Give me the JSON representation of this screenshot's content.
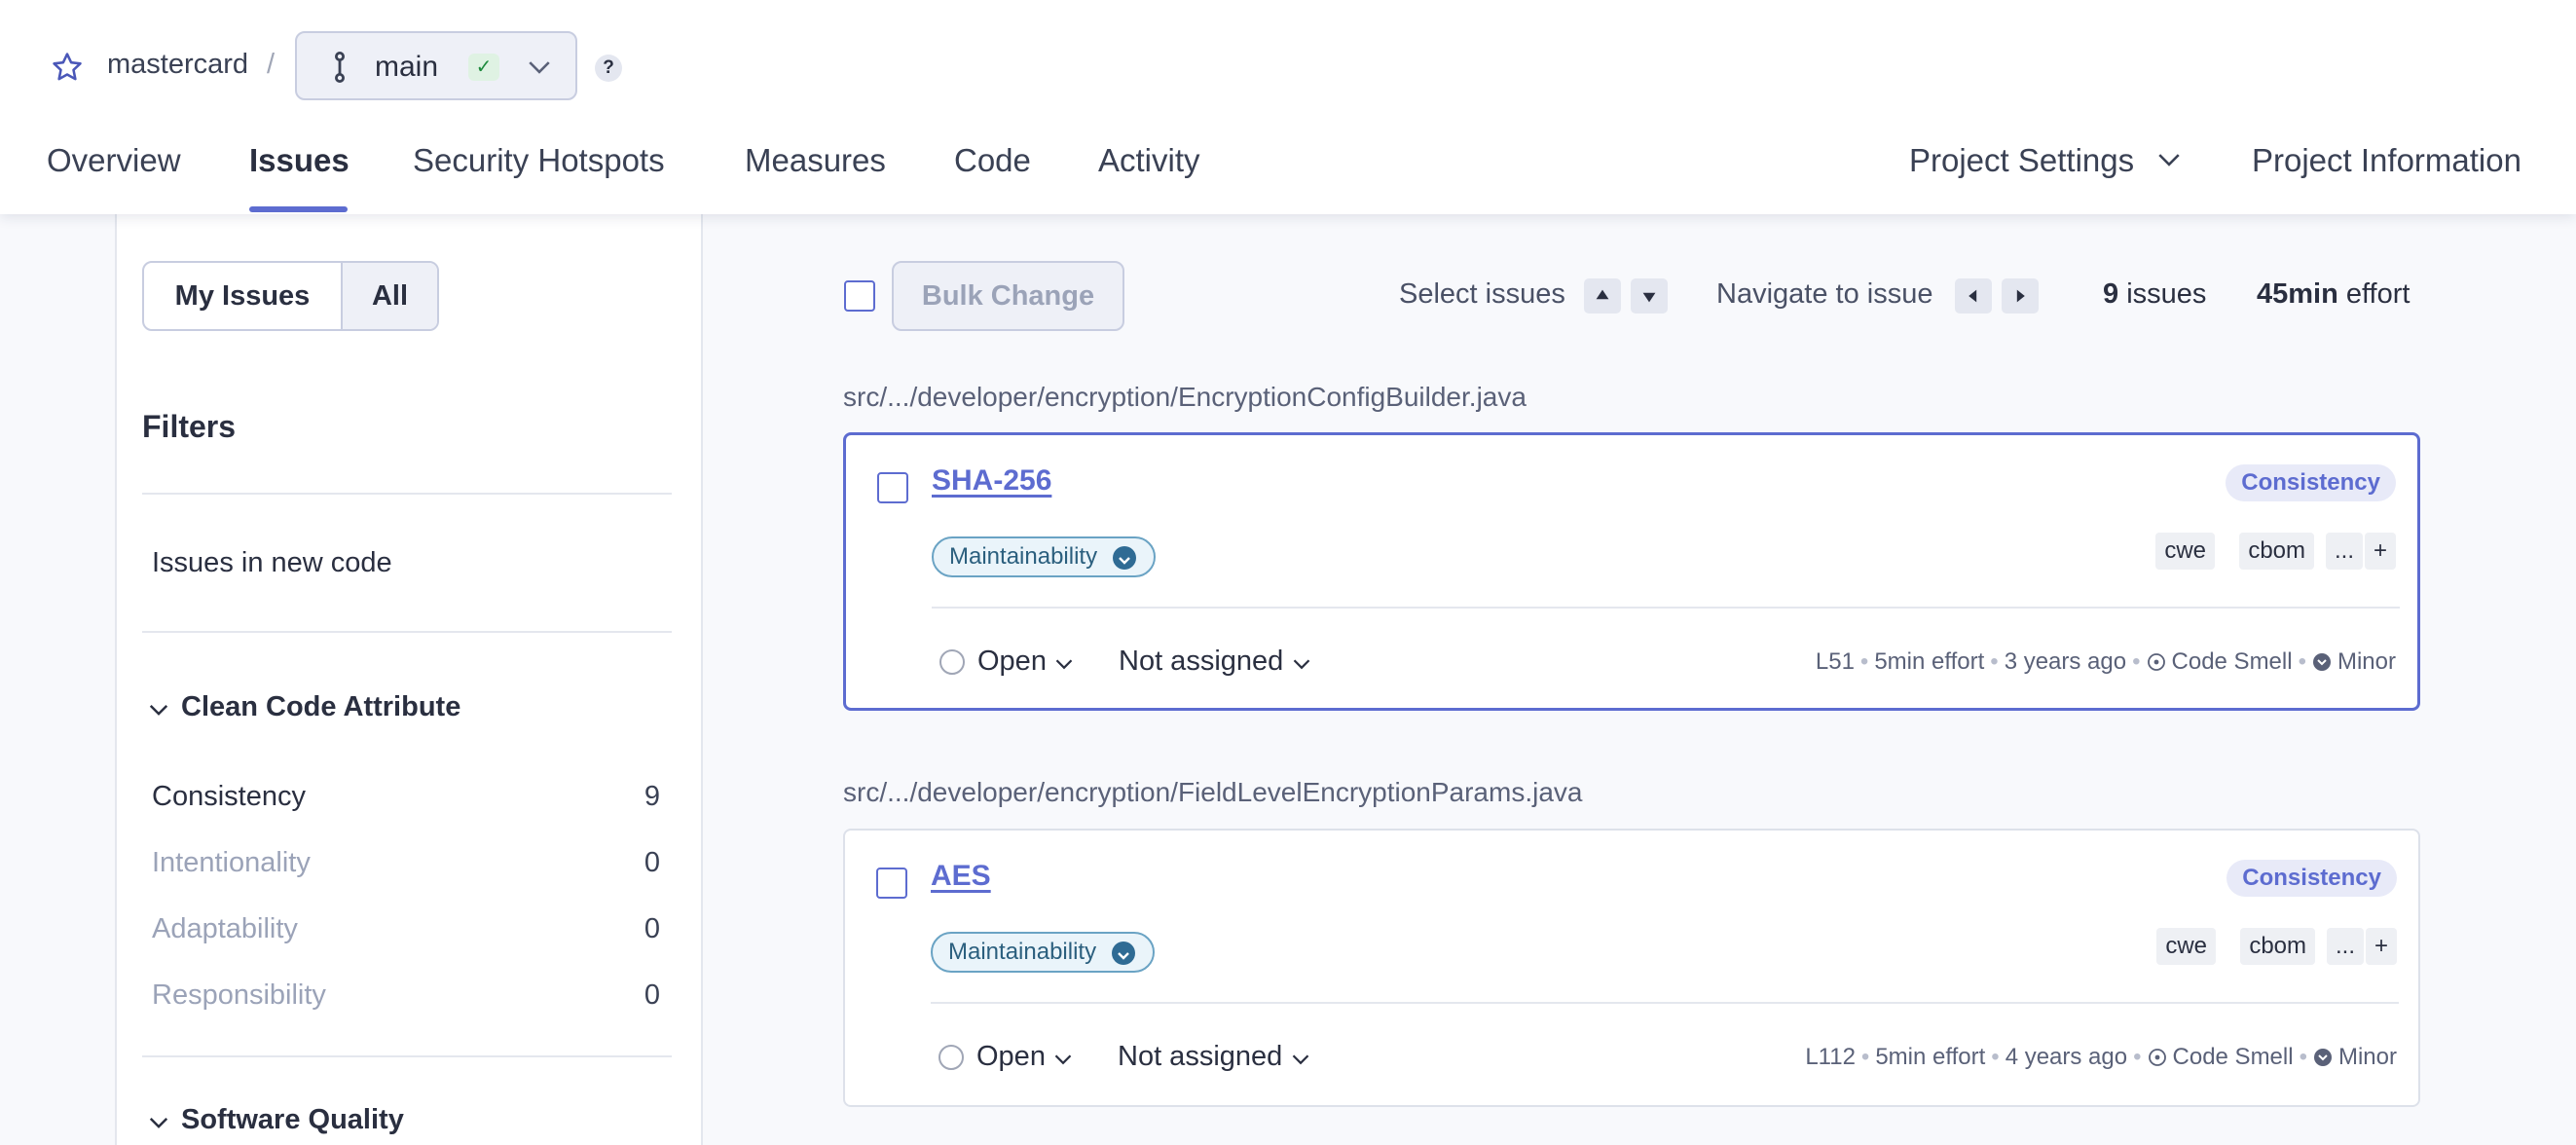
{
  "header": {
    "project_name": "mastercard",
    "separator": "/",
    "branch": {
      "name": "main",
      "status": "✓"
    },
    "help_label": "?",
    "nav": {
      "overview": "Overview",
      "issues": "Issues",
      "security_hotspots": "Security Hotspots",
      "measures": "Measures",
      "code": "Code",
      "activity": "Activity",
      "project_settings": "Project Settings",
      "project_information": "Project Information"
    },
    "active_tab": "Issues"
  },
  "sidebar": {
    "my_issues_label": "My Issues",
    "all_label": "All",
    "filters_heading": "Filters",
    "new_code_label": "Issues in new code",
    "clean_code_section": "Clean Code Attribute",
    "attributes": [
      {
        "label": "Consistency",
        "count": "9"
      },
      {
        "label": "Intentionality",
        "count": "0"
      },
      {
        "label": "Adaptability",
        "count": "0"
      },
      {
        "label": "Responsibility",
        "count": "0"
      }
    ],
    "software_quality_section": "Software Quality"
  },
  "toolbar": {
    "bulk_change_label": "Bulk Change",
    "select_issues_label": "Select issues",
    "navigate_label": "Navigate to issue",
    "issues_count": "9",
    "issues_word": "issues",
    "effort_value": "45min",
    "effort_word": "effort"
  },
  "issues": [
    {
      "file_path": "src/.../developer/encryption/EncryptionConfigBuilder.java",
      "title": "SHA-256",
      "attribute_badge": "Consistency",
      "quality": "Maintainability",
      "tags": [
        "cwe",
        "cbom",
        "...",
        "+"
      ],
      "status": "Open",
      "assignee": "Not assigned",
      "line": "L51",
      "effort": "5min effort",
      "age": "3 years ago",
      "type": "Code Smell",
      "severity": "Minor",
      "selected": true
    },
    {
      "file_path": "src/.../developer/encryption/FieldLevelEncryptionParams.java",
      "title": "AES",
      "attribute_badge": "Consistency",
      "quality": "Maintainability",
      "tags": [
        "cwe",
        "cbom",
        "...",
        "+"
      ],
      "status": "Open",
      "assignee": "Not assigned",
      "line": "L112",
      "effort": "5min effort",
      "age": "4 years ago",
      "type": "Code Smell",
      "severity": "Minor",
      "selected": false
    }
  ],
  "colors": {
    "accent": "#5d6cd0",
    "header_bg": "#ffffff",
    "page_bg": "#f8f9fc",
    "maintainability_border": "#6aa3c4",
    "branch_ok": "#1e8a3d"
  },
  "icons": {
    "favorite": "star-icon",
    "branch": "branch-icon",
    "branch_status": "check-icon",
    "dropdown": "chevron-down-icon",
    "help": "question-icon",
    "navigate_up": "arrow-up-icon",
    "navigate_down": "arrow-down-icon",
    "navigate_left": "arrow-left-icon",
    "navigate_right": "arrow-right-icon",
    "code_smell": "code-smell-icon",
    "severity": "severity-minor-icon"
  }
}
